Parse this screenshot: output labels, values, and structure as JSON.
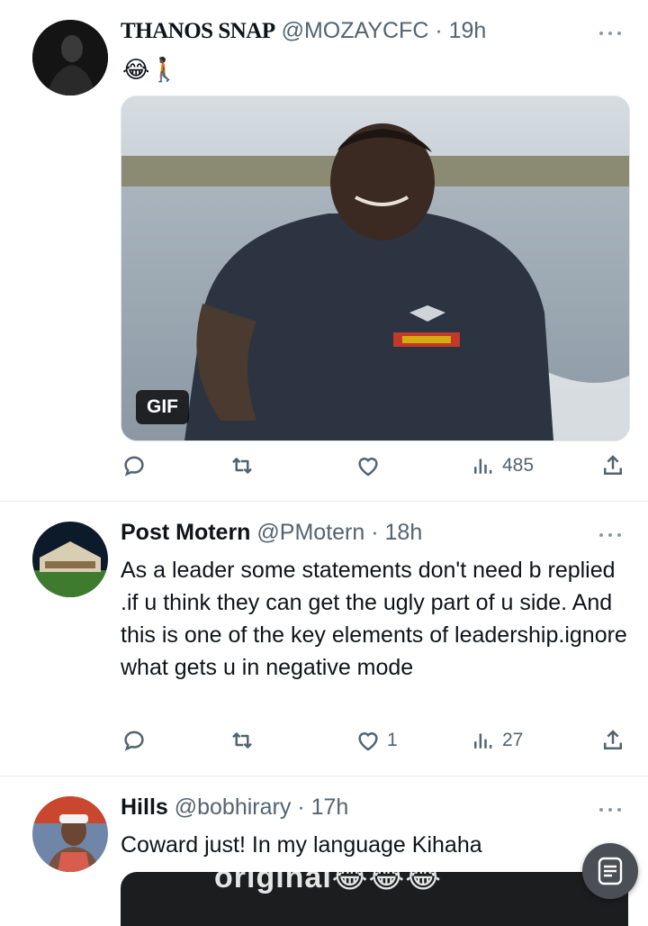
{
  "tweets": [
    {
      "name": "THANOS SNAP",
      "handle": "@MOZAYCFC",
      "time": "· 19h",
      "text": "😂🚶🏿",
      "media_badge": "GIF",
      "counts": {
        "reply": "",
        "retweet": "",
        "like": "",
        "views": "485"
      }
    },
    {
      "name": "Post Motern",
      "handle": "@PMotern",
      "time": "· 18h",
      "text": "As a leader some statements don't need b replied .if u think they can get the ugly part of u side. And this is one of the key elements of leadership.ignore what gets u in negative mode",
      "counts": {
        "reply": "",
        "retweet": "",
        "like": "1",
        "views": "27"
      }
    },
    {
      "name": "Hills",
      "handle": "@bobhirary",
      "time": "· 17h",
      "text": "Coward just! In my language Kihaha",
      "media_caption": "original😂😂😂"
    }
  ],
  "icons": {
    "reply": "reply-icon",
    "retweet": "retweet-icon",
    "like": "heart-icon",
    "views": "views-icon",
    "share": "share-icon",
    "fab": "compose-icon"
  },
  "colors": {
    "text": "#0f1419",
    "muted": "#536471",
    "divider": "#e6e8ea"
  }
}
